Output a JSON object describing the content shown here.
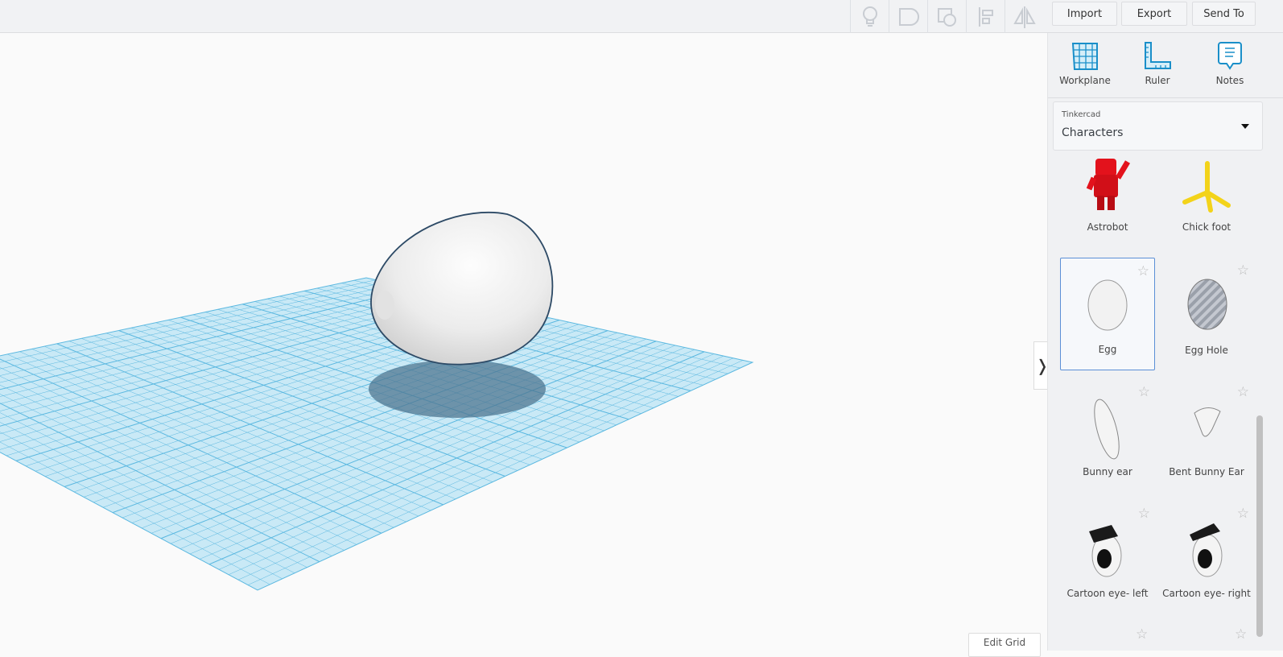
{
  "toolbar": {
    "import": "Import",
    "export": "Export",
    "send_to": "Send To"
  },
  "sidebar": {
    "tools": [
      {
        "label": "Workplane"
      },
      {
        "label": "Ruler"
      },
      {
        "label": "Notes"
      }
    ],
    "library": {
      "provider": "Tinkercad",
      "category": "Characters"
    },
    "shapes": [
      {
        "label": "Astrobot"
      },
      {
        "label": "Chick foot"
      },
      {
        "label": "Egg",
        "selected": true
      },
      {
        "label": "Egg Hole"
      },
      {
        "label": "Bunny ear"
      },
      {
        "label": "Bent Bunny Ear"
      },
      {
        "label": "Cartoon eye- left"
      },
      {
        "label": "Cartoon eye- right"
      }
    ]
  },
  "viewport": {
    "edit_grid": "Edit Grid"
  },
  "colors": {
    "grid": "#5bb8e0",
    "accent": "#1a8fc9",
    "selection": "#5b8fd6"
  }
}
